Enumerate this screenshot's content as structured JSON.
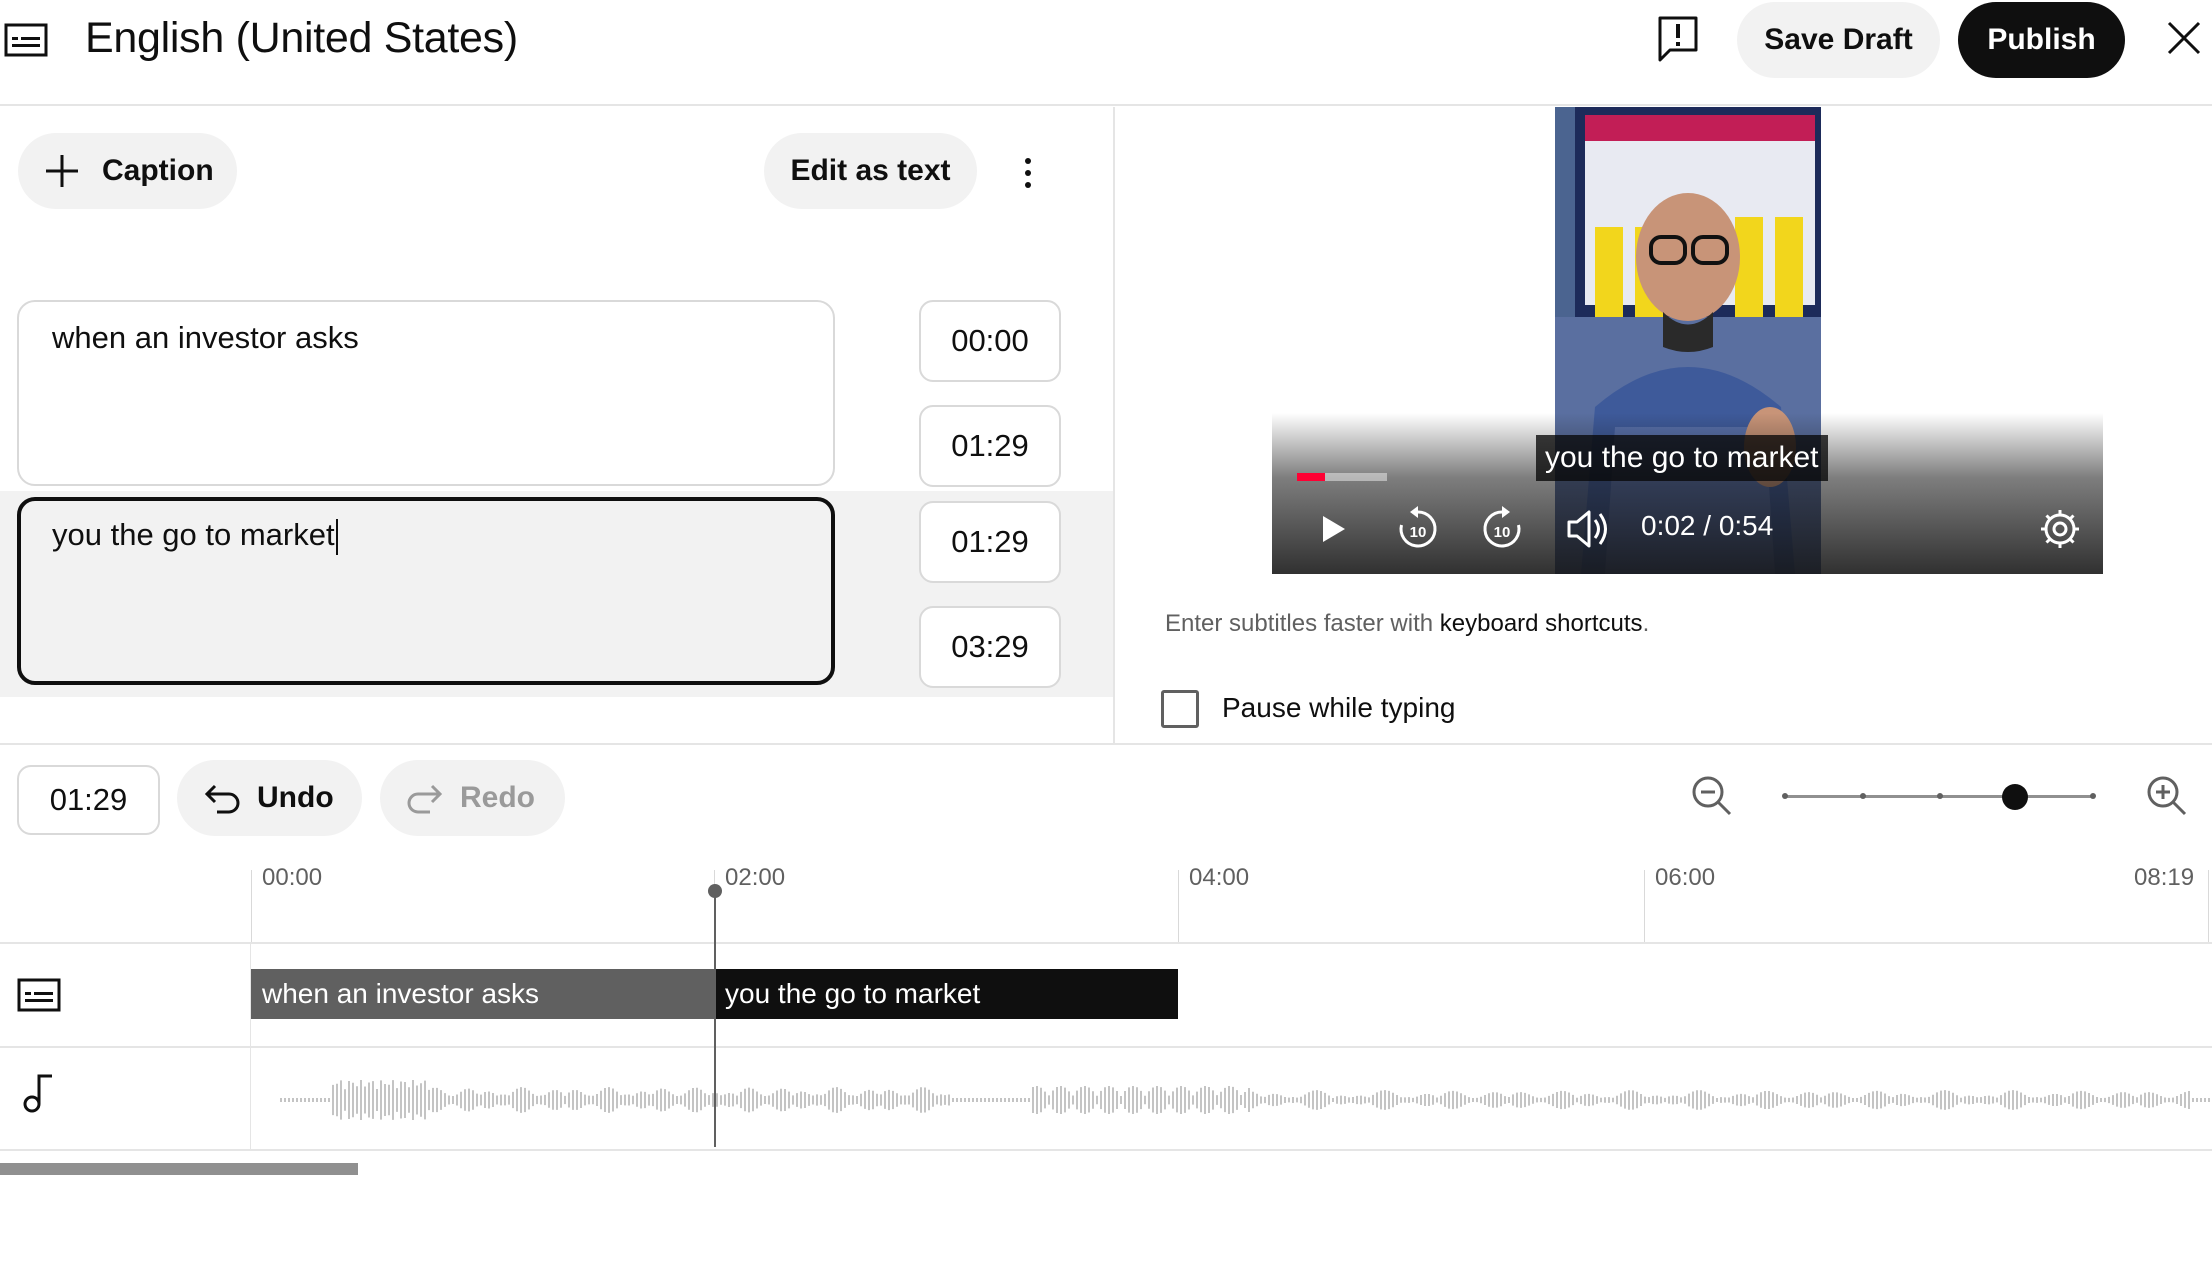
{
  "header": {
    "title": "English (United States)",
    "save_draft_label": "Save Draft",
    "publish_label": "Publish"
  },
  "editor": {
    "add_caption_label": "Caption",
    "edit_as_text_label": "Edit as text",
    "cues": [
      {
        "text": "when an investor asks",
        "start": "00:00",
        "end": "01:29"
      },
      {
        "text": "you the go to market",
        "start": "01:29",
        "end": "03:29"
      }
    ]
  },
  "player": {
    "subtitle": "you the go to market",
    "time": "0:02 / 0:54",
    "progress_fraction": 0.037
  },
  "hint": {
    "prefix": "Enter subtitles faster with ",
    "link": "keyboard shortcuts",
    "suffix": "."
  },
  "pause_while_typing_label": "Pause while typing",
  "timeline": {
    "current_time": "01:29",
    "undo_label": "Undo",
    "redo_label": "Redo",
    "ruler": [
      "00:00",
      "02:00",
      "04:00",
      "06:00",
      "08:19"
    ],
    "segments": [
      "when an investor asks",
      "you the go to market"
    ]
  },
  "icons": {
    "header": "subtitles-icon",
    "feedback": "feedback-icon",
    "close": "close-icon",
    "add": "plus-icon",
    "more": "more-vert-icon",
    "play": "play-icon",
    "rewind": "replay-10-icon",
    "forward": "forward-10-icon",
    "volume": "volume-icon",
    "settings": "gear-icon",
    "zoom_out": "zoom-out-icon",
    "zoom_in": "zoom-in-icon",
    "audio_track": "music-note-icon"
  },
  "colors": {
    "primary": "#0f0f0f",
    "button_bg": "#f2f2f2",
    "progress_red": "#ff0033",
    "muted_text": "#606060"
  }
}
